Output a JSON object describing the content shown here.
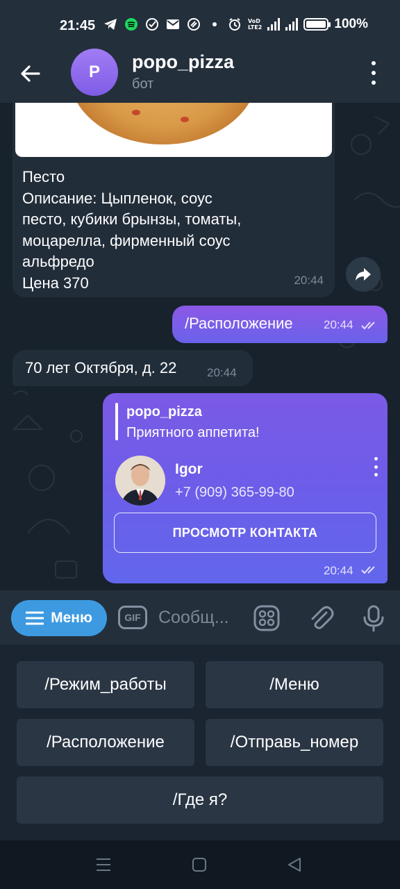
{
  "status_bar": {
    "time": "21:45",
    "battery": "100%",
    "icons": [
      "telegram-icon",
      "spotify-icon",
      "check-circle-icon",
      "mail-icon",
      "app-icon",
      "dot-icon",
      "alarm-icon",
      "volte-icon",
      "4g-signal-icon",
      "signal-icon",
      "battery-icon"
    ]
  },
  "header": {
    "avatar_letter": "P",
    "title": "popo_pizza",
    "subtitle": "бот"
  },
  "messages": {
    "pizza": {
      "text": "Песто\nОписание: Цыпленок, соус\nпесто, кубики брынзы, томаты,\nмоцарелла, фирменный соус\nальфредо\nЦена 370",
      "time": "20:44"
    },
    "location_cmd": {
      "text": "/Расположение",
      "time": "20:44"
    },
    "address": {
      "text": "70 лет Октября, д. 22",
      "time": "20:44"
    },
    "contact": {
      "reply_name": "popo_pizza",
      "reply_text": "Приятного аппетита!",
      "name": "Igor",
      "phone": "+7 (909) 365-99-80",
      "button": "ПРОСМОТР КОНТАКТА",
      "time": "20:44"
    }
  },
  "input_bar": {
    "menu_label": "Меню",
    "gif_label": "GIF",
    "placeholder": "Сообщ..."
  },
  "keyboard": {
    "buttons": [
      "/Режим_работы",
      "/Меню",
      "/Расположение",
      "/Отправь_номер",
      "/Где я?"
    ]
  },
  "colors": {
    "accent": "#3d9ae0",
    "outgoing_bubble": "#7b5ae6",
    "incoming_bubble": "#222d3a",
    "header": "#242f3c"
  }
}
